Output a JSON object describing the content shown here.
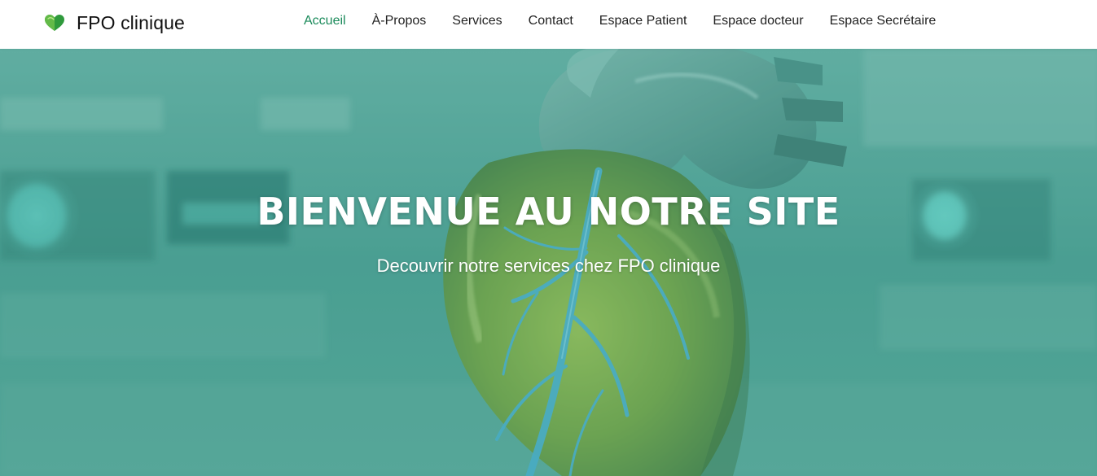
{
  "brand": {
    "name": "FPO clinique",
    "icon": "green-heart-icon",
    "color": "#3aa845"
  },
  "nav": {
    "items": [
      {
        "label": "Accueil",
        "active": true
      },
      {
        "label": "À-Propos",
        "active": false
      },
      {
        "label": "Services",
        "active": false
      },
      {
        "label": "Contact",
        "active": false
      },
      {
        "label": "Espace Patient",
        "active": false
      },
      {
        "label": "Espace docteur",
        "active": false
      },
      {
        "label": "Espace Secrétaire",
        "active": false
      }
    ],
    "active_color": "#1a8a5a"
  },
  "hero": {
    "title": "BIENVENUE AU NOTRE SITE",
    "subtitle": "Decouvrir notre services chez FPO clinique",
    "image": "anatomical-heart-image",
    "overlay_color": "#409c8c"
  }
}
